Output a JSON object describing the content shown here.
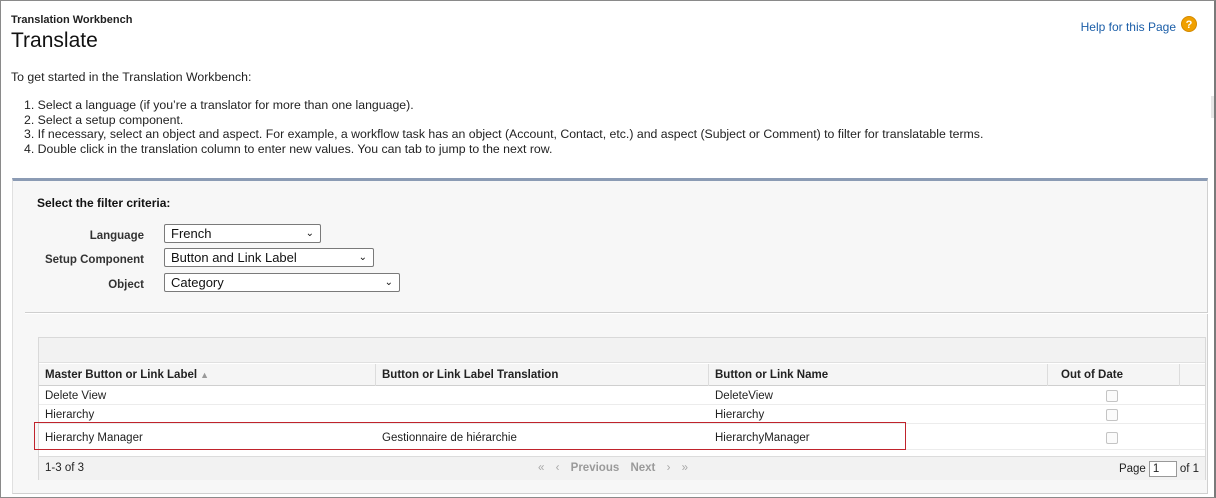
{
  "header": {
    "subtitle": "Translation Workbench",
    "title": "Translate",
    "help_link": "Help for this Page",
    "help_icon": "?"
  },
  "intro": "To get started in the Translation Workbench:",
  "steps": [
    "1. Select a language (if you’re a translator for more than one language).",
    "2. Select a setup component.",
    "3. If necessary, select an object and aspect. For example, a workflow task has an object (Account, Contact, etc.) and aspect (Subject or Comment) to filter for translatable terms.",
    "4. Double click in the translation column to enter new values. You can tab to jump to the next row."
  ],
  "filter": {
    "title": "Select the filter criteria:",
    "language_label": "Language",
    "language_value": "French",
    "component_label": "Setup Component",
    "component_value": "Button and Link Label",
    "object_label": "Object",
    "object_value": "Category",
    "chevron": "⌄"
  },
  "table": {
    "columns": [
      "Master Button or Link Label",
      "Button or Link Label Translation",
      "Button or Link Name",
      "Out of Date"
    ],
    "sort_indicator": "▲",
    "rows": [
      {
        "master": "Delete View",
        "translation": "",
        "name": "DeleteView",
        "out_of_date": false
      },
      {
        "master": "Hierarchy",
        "translation": "",
        "name": "Hierarchy",
        "out_of_date": false
      },
      {
        "master": "Hierarchy Manager",
        "translation": "Gestionnaire de hiérarchie",
        "name": "HierarchyManager",
        "out_of_date": false
      }
    ]
  },
  "pager": {
    "count": "1-3 of 3",
    "first": "«",
    "prev_arrow": "‹",
    "prev": "Previous",
    "next": "Next",
    "next_arrow": "›",
    "last": "»",
    "page_label": "Page",
    "page_value": "1",
    "of_label": "of 1"
  },
  "colors": {
    "highlight": "#c0232c",
    "link": "#1b5ea8",
    "help_icon": "#f0a000",
    "panel_border": "#8b9bb4"
  }
}
